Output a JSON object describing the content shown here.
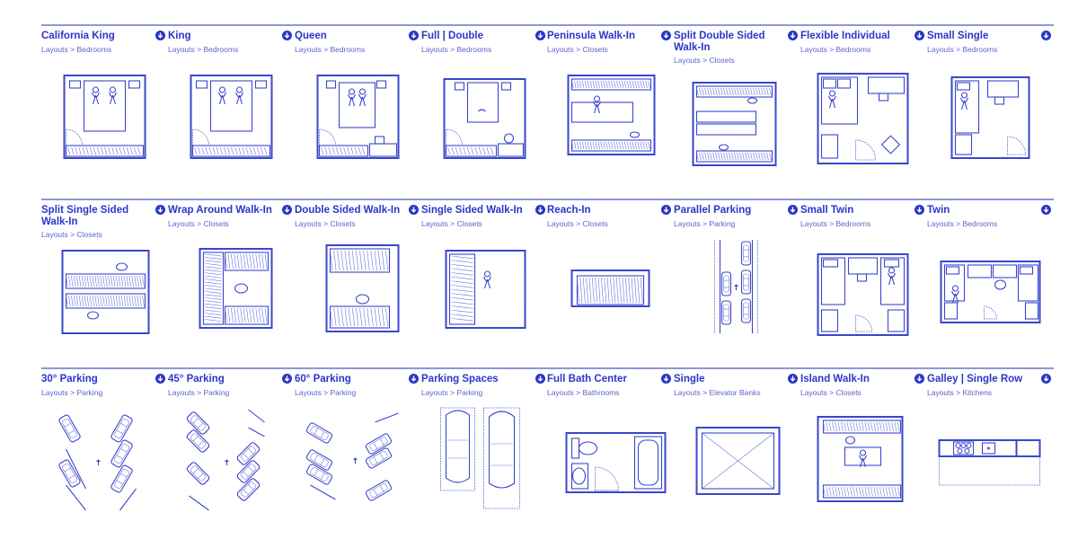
{
  "cards": [
    {
      "title": "California King",
      "crumb": "Layouts > Bedrooms",
      "plan": "bed-king"
    },
    {
      "title": "King",
      "crumb": "Layouts > Bedrooms",
      "plan": "bed-king"
    },
    {
      "title": "Queen",
      "crumb": "Layouts > Bedrooms",
      "plan": "bed-queen"
    },
    {
      "title": "Full | Double",
      "crumb": "Layouts > Bedrooms",
      "plan": "bed-full"
    },
    {
      "title": "Peninsula Walk-In",
      "crumb": "Layouts > Closets",
      "plan": "closet-peninsula"
    },
    {
      "title": "Split Double Sided Walk-In",
      "crumb": "Layouts > Closets",
      "plan": "closet-split-double"
    },
    {
      "title": "Flexible Individual",
      "crumb": "Layouts > Bedrooms",
      "plan": "bed-flex"
    },
    {
      "title": "Small Single",
      "crumb": "Layouts > Bedrooms",
      "plan": "bed-small-single"
    },
    {
      "title": "Split Single Sided Walk-In",
      "crumb": "Layouts > Closets",
      "plan": "closet-split-single"
    },
    {
      "title": "Wrap Around Walk-In",
      "crumb": "Layouts > Closets",
      "plan": "closet-wrap"
    },
    {
      "title": "Double Sided Walk-In",
      "crumb": "Layouts > Closets",
      "plan": "closet-double"
    },
    {
      "title": "Single Sided Walk-In",
      "crumb": "Layouts > Closets",
      "plan": "closet-single"
    },
    {
      "title": "Reach-In",
      "crumb": "Layouts > Closets",
      "plan": "closet-reach"
    },
    {
      "title": "Parallel Parking",
      "crumb": "Layouts > Parking",
      "plan": "park-parallel"
    },
    {
      "title": "Small Twin",
      "crumb": "Layouts > Bedrooms",
      "plan": "bed-small-twin"
    },
    {
      "title": "Twin",
      "crumb": "Layouts > Bedrooms",
      "plan": "bed-twin"
    },
    {
      "title": "30° Parking",
      "crumb": "Layouts > Parking",
      "plan": "park-30"
    },
    {
      "title": "45° Parking",
      "crumb": "Layouts > Parking",
      "plan": "park-45"
    },
    {
      "title": "60° Parking",
      "crumb": "Layouts > Parking",
      "plan": "park-60"
    },
    {
      "title": "Parking Spaces",
      "crumb": "Layouts > Parking",
      "plan": "park-spaces"
    },
    {
      "title": "Full Bath Center",
      "crumb": "Layouts > Bathrooms",
      "plan": "bath"
    },
    {
      "title": "Single",
      "crumb": "Layouts > Elevator Banks",
      "plan": "elevator"
    },
    {
      "title": "Island Walk-In",
      "crumb": "Layouts > Closets",
      "plan": "closet-island"
    },
    {
      "title": "Galley | Single Row",
      "crumb": "Layouts > Kitchens",
      "plan": "kitchen-galley"
    }
  ],
  "icons": {
    "download": "download-circle-icon"
  },
  "colors": {
    "accent": "#2a36c8",
    "rule": "#8e96dc",
    "crumb": "#5a63cf"
  }
}
